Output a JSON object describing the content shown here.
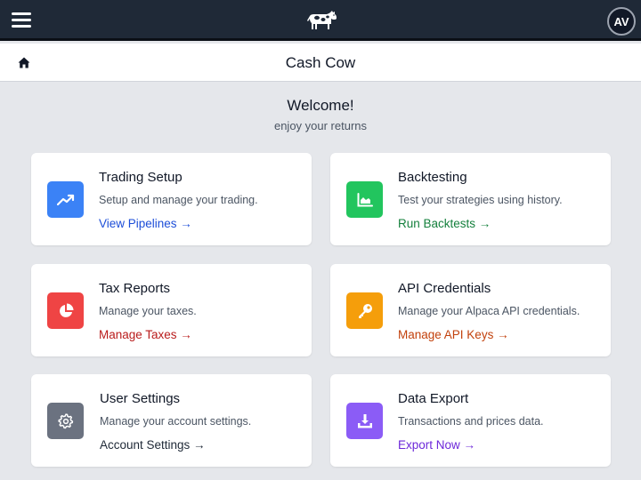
{
  "topbar": {
    "logo_icon": "cow-logo-icon",
    "menu_icon": "hamburger-menu-icon",
    "avatar_initials": "AV"
  },
  "header": {
    "home_icon": "home-icon",
    "title": "Cash Cow"
  },
  "welcome": {
    "title": "Welcome!",
    "subtitle": "enjoy your returns"
  },
  "cards": [
    {
      "title": "Trading Setup",
      "description": "Setup and manage your trading.",
      "link": "View Pipelines →",
      "icon": "trending-up-icon",
      "icon_color": "#3b82f6",
      "link_color": "#1d4ed8"
    },
    {
      "title": "Backtesting",
      "description": "Test your strategies using history.",
      "link": "Run Backtests →",
      "icon": "area-chart-icon",
      "icon_color": "#22c55e",
      "link_color": "#15803d"
    },
    {
      "title": "Tax Reports",
      "description": "Manage your taxes.",
      "link": "Manage Taxes →",
      "icon": "pie-chart-icon",
      "icon_color": "#ef4444",
      "link_color": "#b91c1c"
    },
    {
      "title": "API Credentials",
      "description": "Manage your Alpaca API credentials.",
      "link": "Manage API Keys →",
      "icon": "key-icon",
      "icon_color": "#f59e0b",
      "link_color": "#c2410c"
    },
    {
      "title": "User Settings",
      "description": "Manage your account settings.",
      "link": "Account Settings →",
      "icon": "gear-icon",
      "icon_color": "#6b7280",
      "link_color": "#1f2937"
    },
    {
      "title": "Data Export",
      "description": "Transactions and prices data.",
      "link": "Export Now →",
      "icon": "download-icon",
      "icon_color": "#8b5cf6",
      "link_color": "#6d28d9"
    }
  ]
}
